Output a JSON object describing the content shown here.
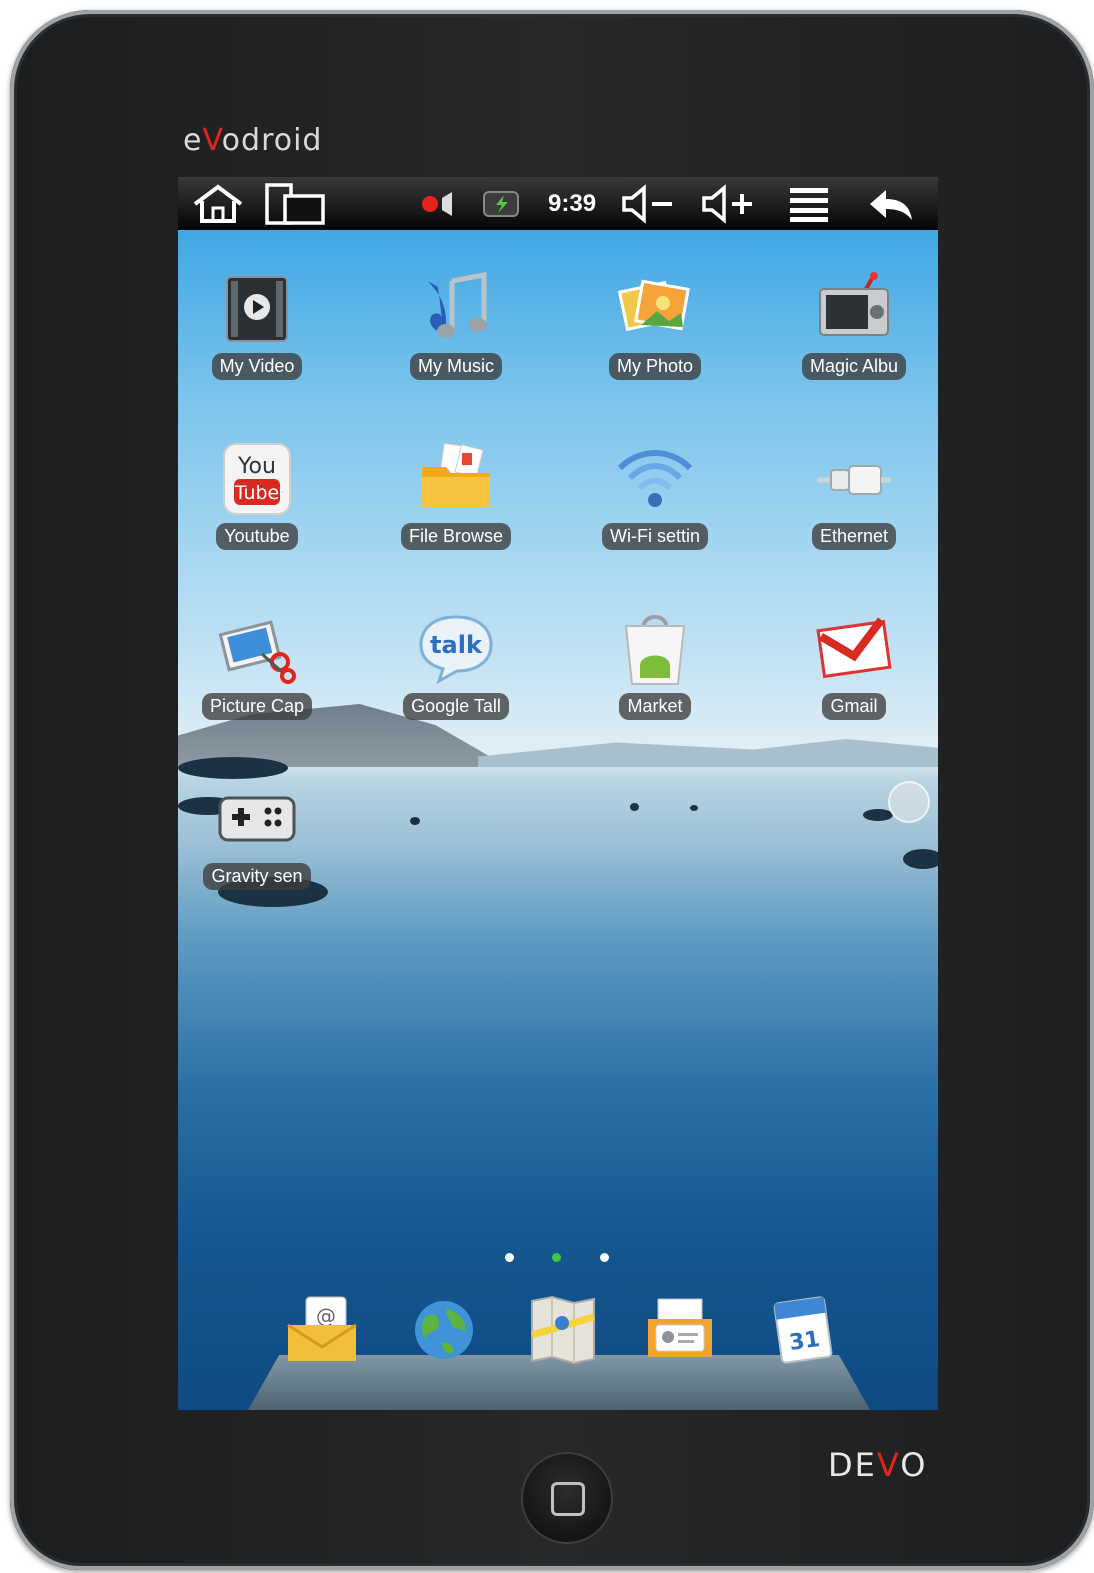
{
  "device": {
    "brand_prefix": "e",
    "brand_v": "V",
    "brand_suffix": "odroid",
    "maker_prefix": "DE",
    "maker_v": "V",
    "maker_suffix": "O"
  },
  "statusbar": {
    "time": "9:39",
    "icons": [
      "home-icon",
      "recent-apps-icon",
      "recording-icon",
      "battery-icon",
      "volume-down-icon",
      "volume-up-icon",
      "menu-icon",
      "back-icon"
    ]
  },
  "apps": [
    {
      "label": "My Video",
      "icon": "video-icon"
    },
    {
      "label": "My Music",
      "icon": "music-icon"
    },
    {
      "label": "My Photo",
      "icon": "photo-icon"
    },
    {
      "label": "Magic Albu",
      "icon": "magic-album-icon"
    },
    {
      "label": "Youtube",
      "icon": "youtube-icon"
    },
    {
      "label": "File Browse",
      "icon": "folder-icon"
    },
    {
      "label": "Wi-Fi settin",
      "icon": "wifi-icon"
    },
    {
      "label": "Ethernet",
      "icon": "ethernet-icon"
    },
    {
      "label": "Picture Cap",
      "icon": "picture-capture-icon"
    },
    {
      "label": "Google Tall",
      "icon": "google-talk-icon"
    },
    {
      "label": "Market",
      "icon": "market-icon"
    },
    {
      "label": "Gmail",
      "icon": "gmail-icon"
    },
    {
      "label": "Gravity sen",
      "icon": "gamepad-icon"
    }
  ],
  "talk_icon_text": "talk",
  "youtube_icon_text": {
    "top": "You",
    "bottom": "Tube"
  },
  "pager": {
    "pages": 3,
    "active": 2
  },
  "dock": [
    {
      "icon": "email-icon"
    },
    {
      "icon": "browser-globe-icon"
    },
    {
      "icon": "maps-icon"
    },
    {
      "icon": "contacts-icon"
    },
    {
      "icon": "calendar-icon",
      "text": "31"
    }
  ],
  "colors": {
    "accent_red": "#e4241c",
    "active_dot": "#3ccb3c",
    "bezel": "#222425"
  }
}
